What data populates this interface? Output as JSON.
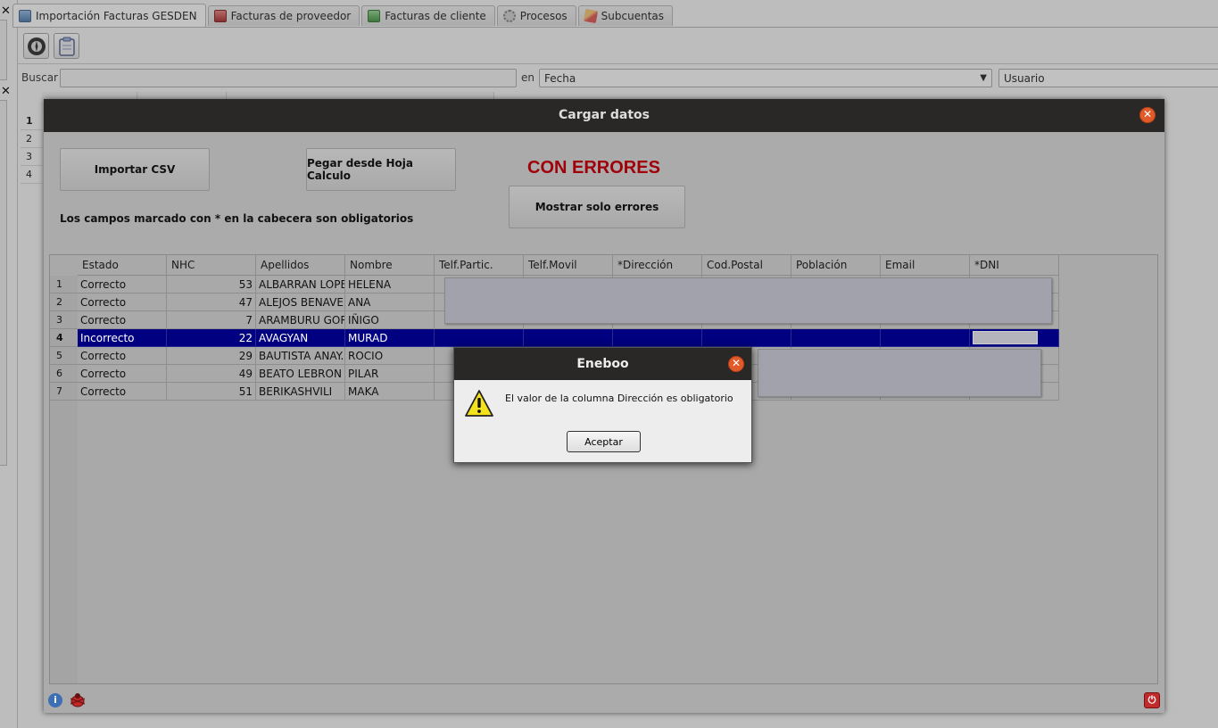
{
  "tabs": [
    {
      "label": "Importación Facturas GESDEN",
      "icon": "database-icon",
      "active": true
    },
    {
      "label": "Facturas de proveedor",
      "icon": "supplier-invoice-icon",
      "active": false
    },
    {
      "label": "Facturas de cliente",
      "icon": "customer-invoice-icon",
      "active": false
    },
    {
      "label": "Procesos",
      "icon": "gear-icon",
      "active": false
    },
    {
      "label": "Subcuentas",
      "icon": "pencil-icon",
      "active": false
    }
  ],
  "search": {
    "label": "Buscar",
    "value": "",
    "in_label": "en",
    "field_value": "Fecha",
    "user_value": "Usuario"
  },
  "background_rows": [
    "1",
    "2",
    "3",
    "4"
  ],
  "dialog": {
    "title": "Cargar datos",
    "import_csv_label": "Importar CSV",
    "paste_label": "Pegar desde Hoja Calculo",
    "status_title": "CON ERRORES",
    "show_errors_label": "Mostrar solo errores",
    "required_note": "Los campos marcado con * en la cabecera son obligatorios",
    "columns": [
      "Estado",
      "NHC",
      "Apellidos",
      "Nombre",
      "Telf.Partic.",
      "Telf.Movil",
      "*Dirección",
      "Cod.Postal",
      "Población",
      "Email",
      "*DNI"
    ],
    "rows": [
      {
        "num": "1",
        "estado": "Correcto",
        "nhc": "53",
        "apellidos": "ALBARRAN LOPE",
        "nombre": "HELENA"
      },
      {
        "num": "2",
        "estado": "Correcto",
        "nhc": "47",
        "apellidos": "ALEJOS BENAVEI",
        "nombre": "ANA"
      },
      {
        "num": "3",
        "estado": "Correcto",
        "nhc": "7",
        "apellidos": "ARAMBURU GOR",
        "nombre": "IÑIGO"
      },
      {
        "num": "4",
        "estado": "Incorrecto",
        "nhc": "22",
        "apellidos": "AVAGYAN",
        "nombre": "MURAD"
      },
      {
        "num": "5",
        "estado": "Correcto",
        "nhc": "29",
        "apellidos": "BAUTISTA ANAY.",
        "nombre": "ROCIO"
      },
      {
        "num": "6",
        "estado": "Correcto",
        "nhc": "49",
        "apellidos": "BEATO LEBRON",
        "nombre": "PILAR"
      },
      {
        "num": "7",
        "estado": "Correcto",
        "nhc": "51",
        "apellidos": "BERIKASHVILI",
        "nombre": "MAKA"
      }
    ],
    "selected_row": 4
  },
  "message_box": {
    "title": "Eneboo",
    "icon": "warning-icon",
    "text": "El valor de la columna Dirección es obligatorio",
    "ok_label": "Aceptar"
  },
  "colors": {
    "selection": "#000080",
    "error_title": "#a0000a",
    "close_button": "#e15b2a",
    "title_bar": "#2a2827"
  }
}
